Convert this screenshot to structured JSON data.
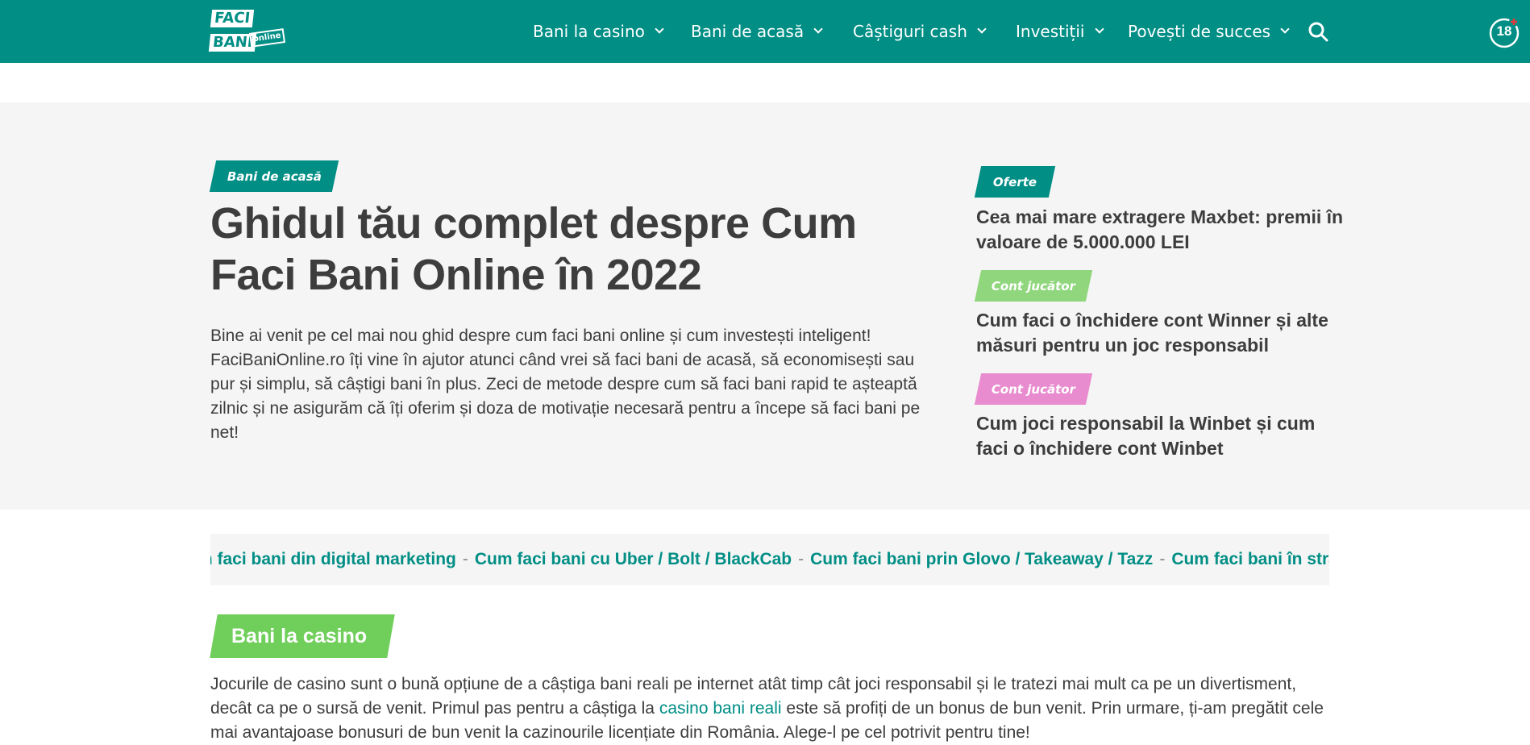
{
  "header": {
    "logo": {
      "line1": "FACI",
      "line2": "BANI",
      "line3": "online"
    },
    "nav": [
      {
        "label": "Bani la casino"
      },
      {
        "label": "Bani de acasă"
      },
      {
        "label": "Câștiguri cash"
      },
      {
        "label": "Investiții"
      },
      {
        "label": "Povești de succes"
      }
    ],
    "age_badge": "18"
  },
  "hero": {
    "category": "Bani de acasă",
    "title_line1": "Ghidul tău complet despre Cum",
    "title_line2": "Faci Bani Online în 2022",
    "intro": "Bine ai venit pe cel mai nou ghid despre cum faci bani online și cum investești inteligent! FaciBaniOnline.ro îți vine în ajutor atunci când vrei să faci bani de acasă, să economisești sau pur și simplu, să câștigi bani în plus. Zeci de metode despre cum să faci bani rapid te așteaptă zilnic și ne asigurăm că îți oferim și doza de motivație necesară pentru a începe să faci bani pe net!"
  },
  "sidebar": [
    {
      "tag": "Oferte",
      "tag_color": "#008e85",
      "title": "Cea mai mare extragere Maxbet: premii în valoare de 5.000.000 LEI"
    },
    {
      "tag": "Cont jucător",
      "tag_color": "#8fd67c",
      "title": "Cum faci o închidere cont Winner și alte măsuri pentru un joc responsabil"
    },
    {
      "tag": "Cont jucător",
      "tag_color": "#e98bcf",
      "title": "Cum joci responsabil la Winbet și cum faci o închidere cont Winbet"
    }
  ],
  "ticker": {
    "links": [
      "Cum faci bani din digital marketing",
      "Cum faci bani cu Uber / Bolt / BlackCab",
      "Cum faci bani prin Glovo / Takeaway / Tazz",
      "Cum faci bani în străinătate"
    ],
    "separator": "-"
  },
  "section": {
    "title": "Bani la casino",
    "text_before": "Jocurile de casino sunt o bună opțiune de a câștiga bani reali pe internet atât timp cât joci responsabil și le tratezi mai mult ca pe un divertisment, decât ca pe o sursă de venit. Primul pas pentru a câștiga la ",
    "link": "casino bani reali",
    "text_after": " este să profiți de un bonus de bun venit. Prin urmare, ți-am pregătit cele mai avantajoase bonusuri de bun venit la cazinourile licențiate din România. Alege-l pe cel potrivit pentru tine!"
  },
  "colors": {
    "brand": "#008e85",
    "hero_bg": "#f5f5f5",
    "section_tag": "#6fcf5a",
    "text": "#3d3d3d"
  }
}
